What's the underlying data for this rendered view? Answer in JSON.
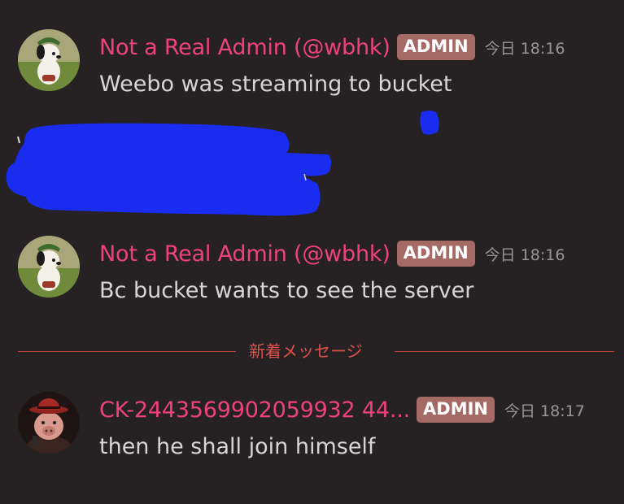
{
  "messages": [
    {
      "avatar_icon": "dog-avatar-icon",
      "username": "Not a Real Admin (@wbhk)",
      "role_badge": "ADMIN",
      "timestamp": "今日 18:16",
      "text": "Weebo was streaming to bucket"
    },
    {
      "avatar_icon": "dog-avatar-icon",
      "username": "Not a Real Admin (@wbhk)",
      "role_badge": "ADMIN",
      "timestamp": "今日 18:16",
      "text": "Bc bucket wants to see the server"
    },
    {
      "avatar_icon": "pig-avatar-icon",
      "username": "CK-2443569902059932 44...",
      "role_badge": "ADMIN",
      "timestamp": "今日 18:17",
      "text": "then he shall join himself"
    }
  ],
  "new_messages_divider": "新着メッセージ",
  "colors": {
    "background": "#262224",
    "username": "#f0427a",
    "badge": "#a66a66",
    "divider": "#c8453f",
    "redaction": "#1a2cf0"
  }
}
